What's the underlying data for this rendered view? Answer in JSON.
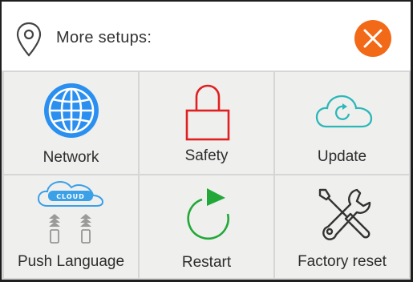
{
  "header": {
    "title": "More setups:",
    "location_icon": "location-pin-icon",
    "close_icon": "close-icon",
    "close_color": "#f26a18"
  },
  "tiles": [
    {
      "label": "Network",
      "icon": "globe-icon",
      "color": "#2b8ff0"
    },
    {
      "label": "Safety",
      "icon": "padlock-icon",
      "color": "#e02020"
    },
    {
      "label": "Update",
      "icon": "cloud-sync-icon",
      "color": "#2ab8b8"
    },
    {
      "label": "Push Language",
      "icon": "cloud-push-icon",
      "color": "#3aa0e8",
      "icon_text": "CLOUD"
    },
    {
      "label": "Restart",
      "icon": "restart-icon",
      "color": "#22a838"
    },
    {
      "label": "Factory reset",
      "icon": "tools-icon",
      "color": "#333333"
    }
  ]
}
